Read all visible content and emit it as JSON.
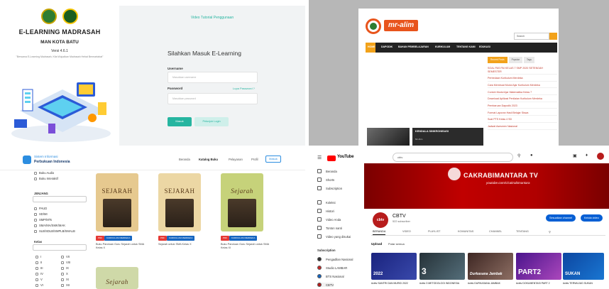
{
  "elearning": {
    "title": "E-LEARNING MADRASAH",
    "school": "MAN KOTA BATU",
    "version": "Versi 4.6.1",
    "tagline": "\"Bersama E-Learning Madrasah, Kita Wujudkan Madrasah Hebat Bermartabat\"",
    "tutorial_link": "Video Tutorial Penggunaan",
    "login_title": "Silahkan Masuk E-Learning",
    "username_label": "Username",
    "username_placeholder": "Masukkan username",
    "password_label": "Password",
    "password_placeholder": "Masukkan password",
    "forgot_link": "Lupa Password ?",
    "login_button": "Masuk",
    "hint_button": "Petunjuk Login",
    "accent_color": "#26b5a0"
  },
  "mralim": {
    "brand": "mr-alim",
    "search_value": "Search",
    "nav": [
      "HOME",
      "DAPODIK",
      "BAHAN PEMBELAJARAN",
      "KURIKULUM",
      "TENTANG KAMI",
      "EDUKASI"
    ],
    "tabs": [
      "Recent Posts",
      "Popular",
      "Tags"
    ],
    "recent": [
      "SOAL PAS PAI KELAS 7 SMP 2020 SETENGAH SEMESTER",
      "Perbedaan Kurikulum Merdeka",
      "Cara Membuat Modul Ajar Kurikulum Merdeka",
      "Contoh Modul Ajar Matematika Kelas 7",
      "Download Aplikasi Penilaian Kurikulum Merdeka",
      "Pembaruan Dapodik 2023",
      "Format Laporan Hasil Belajar Siswa",
      "Soal PTS Kelas 4 SD",
      "Jadwal Asesmen Nasional"
    ],
    "section_heading": "KENDALA SINKRONISASI",
    "post_title": "KENDALA SINKRONISASI",
    "post_meta": "Mr-Alim"
  },
  "buku": {
    "brand_top": "Sistem Informasi",
    "brand_bottom": "Perbukuan Indonesia",
    "nav": [
      "Beranda",
      "Katalog Buku",
      "Pelayanan",
      "Profil"
    ],
    "login_button": "Masuk",
    "filter_top": [
      "Buku Audio",
      "Buku Interaktif"
    ],
    "jenjang_label": "JENJANG",
    "jenjang": [
      "PAUD",
      "SD/MI",
      "SMP/MTs",
      "SMA/MA/SMK/MAK",
      "SLB/SDLB/SMPLB/SMALB"
    ],
    "kelas_label": "Kelas",
    "kelas": [
      "I",
      "II",
      "III",
      "IV",
      "V",
      "VI",
      "VII",
      "VIII",
      "IX",
      "X",
      "XI",
      "XII"
    ],
    "books": [
      {
        "label": "SEJARAH",
        "badge1": "PDF",
        "badge2": "KURIKULUM MERDEKA",
        "title": "Buku Panduan Guru Sejarah untuk SMA Kelas X"
      },
      {
        "label": "SEJARAH",
        "badge1": "PDF",
        "badge2": "KURIKULUM MERDEKA",
        "title": "Sejarah untuk SMA Kelas X"
      },
      {
        "label": "Sejarah",
        "badge1": "PDF",
        "badge2": "KURIKULUM MERDEKA",
        "title": "Buku Panduan Guru Sejarah untuk SMA Kelas XI"
      },
      {
        "label": "Sejarah",
        "badge1": "",
        "badge2": "",
        "title": ""
      }
    ]
  },
  "youtube": {
    "logo_text": "YouTube",
    "search_placeholder": "cbtv",
    "sidebar": [
      "Beranda",
      "Shorts",
      "Subscription",
      "Koleksi",
      "Histori",
      "Video Anda",
      "Tonton nanti",
      "Video yang disukai"
    ],
    "subs_label": "Subscription",
    "subs": [
      "Pengadilan Nasional",
      "Studio LAMBAR",
      "BTS Nasional",
      "CBTV"
    ],
    "banner_title": "CAKRABIMANTARA TV",
    "banner_sub": "youtube.com/c/cakrabimantara",
    "avatar_text": "cbtv",
    "channel_name": "CBTV",
    "channel_subs": "522 subscriber",
    "btn_customize": "Sesuaikan channel",
    "btn_manage": "Kelola video",
    "tabs": [
      "BERANDA",
      "VIDEO",
      "PLAYLIST",
      "KOMUNITAS",
      "CHANNEL",
      "TENTANG"
    ],
    "uploads_label": "Upload",
    "play_all": "Putar semua",
    "videos": [
      {
        "thumb": "2022",
        "caption": "#cbtv SANTRI DAN MURID 2022"
      },
      {
        "thumb": "3",
        "caption": "#cbtv 3 METODOLOGI INDONESIA"
      },
      {
        "thumb": "Durkasana Jambak",
        "caption": "#cbtv DURKASANA JAMBAK"
      },
      {
        "thumb": "PART2",
        "caption": "#cbtv DOKUMENTASI PART 2"
      },
      {
        "thumb": "SUKAN",
        "caption": "#cbtv TERWUJUD SUKAN"
      }
    ],
    "brand_color": "#ff0000"
  }
}
